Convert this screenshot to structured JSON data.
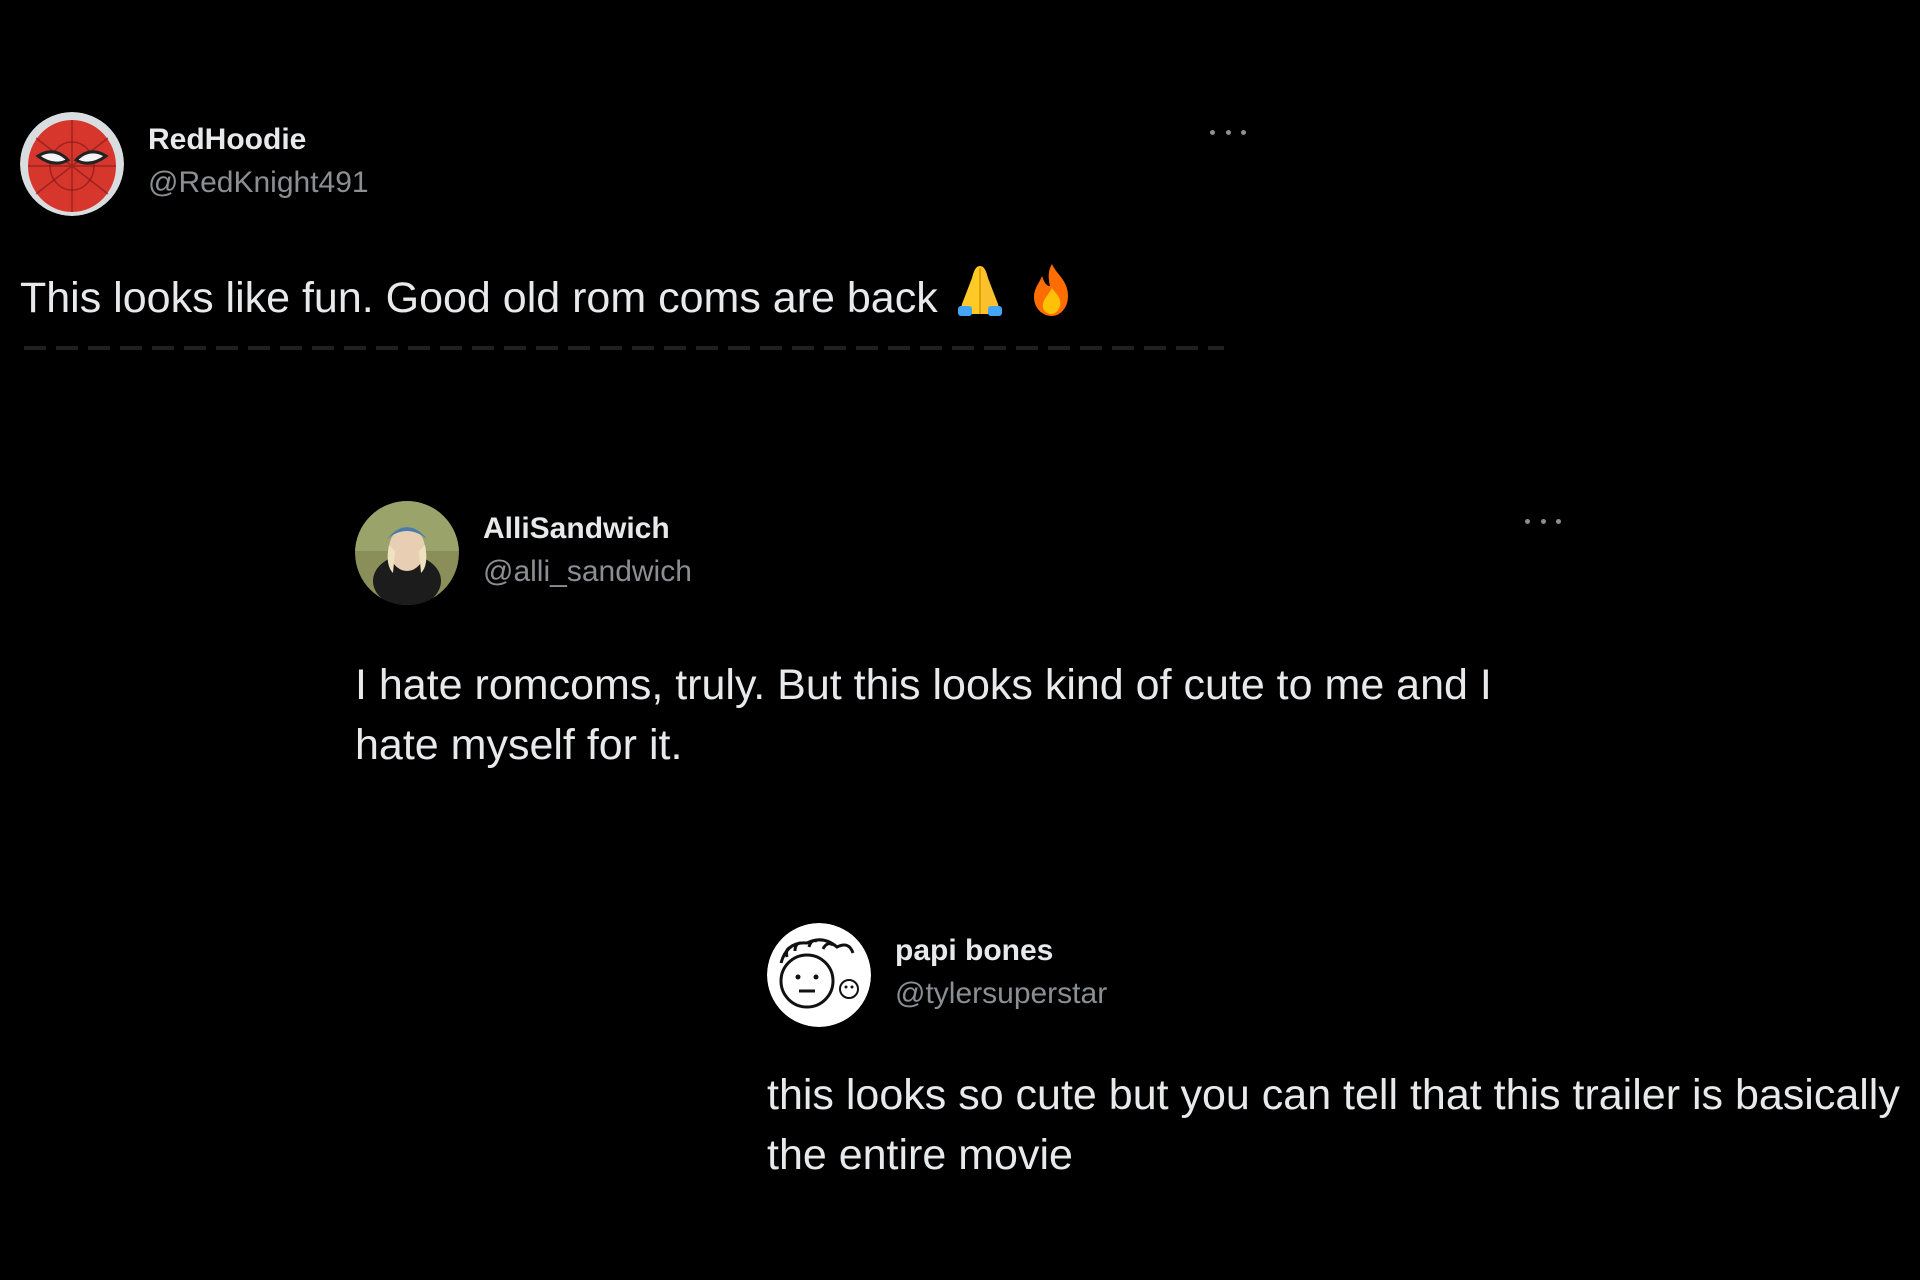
{
  "tweets": [
    {
      "name": "RedHoodie",
      "handle": "@RedKnight491",
      "text": "This looks like fun. Good old rom coms are back",
      "emojis": [
        "folded-hands-emoji",
        "fire-emoji"
      ]
    },
    {
      "name": "AlliSandwich",
      "handle": "@alli_sandwich",
      "text": "I hate romcoms, truly. But this looks kind of cute to me and I hate myself for it."
    },
    {
      "name": "papi bones",
      "handle": "@tylersuperstar",
      "text": "this looks so cute but you can tell that this trailer is basically the entire movie"
    }
  ],
  "colors": {
    "background": "#000000",
    "name_text": "#e7e9ea",
    "handle_text": "#8b8f93"
  }
}
